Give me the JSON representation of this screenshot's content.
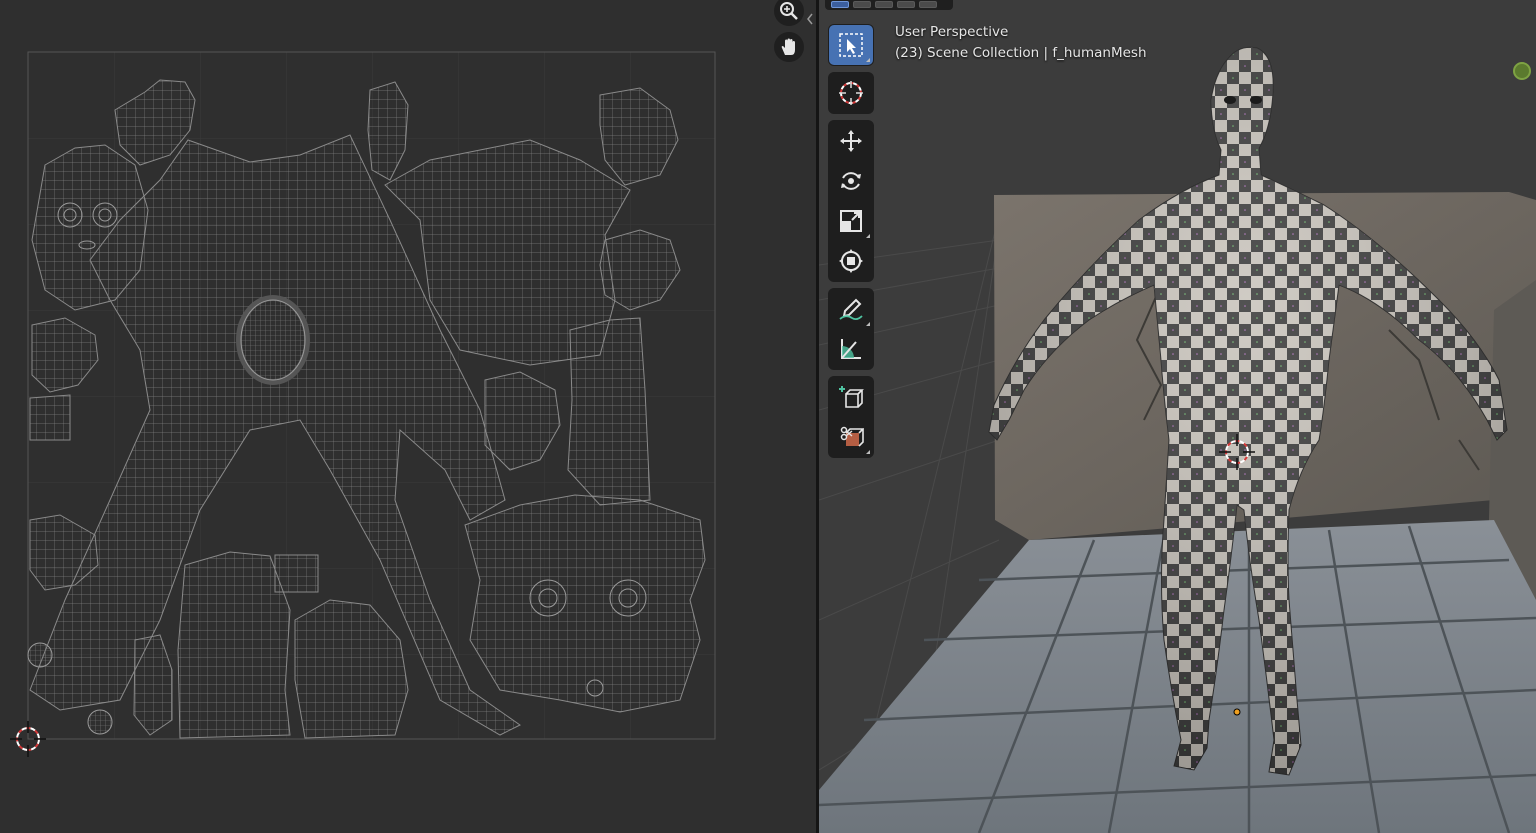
{
  "viewport": {
    "perspective_label": "User Perspective",
    "collection_label": "(23) Scene Collection | f_humanMesh"
  },
  "uv_editor": {
    "nav_icons": [
      "zoom-in-icon",
      "hand-pan-icon"
    ]
  },
  "toolbar": {
    "groups": [
      [
        "select-box-icon"
      ],
      [
        "cursor-icon"
      ],
      [
        "move-icon",
        "rotate-icon",
        "scale-icon",
        "transform-icon"
      ],
      [
        "annotate-icon",
        "measure-icon"
      ],
      [
        "add-cube-icon",
        "extrude-icon"
      ]
    ],
    "active": "select-box-icon"
  },
  "colors": {
    "accent": "#4772b3",
    "uv_wire": "#5c5c5c",
    "checker_dark": "#3a3a3a",
    "checker_light": "#c9c4bc"
  }
}
